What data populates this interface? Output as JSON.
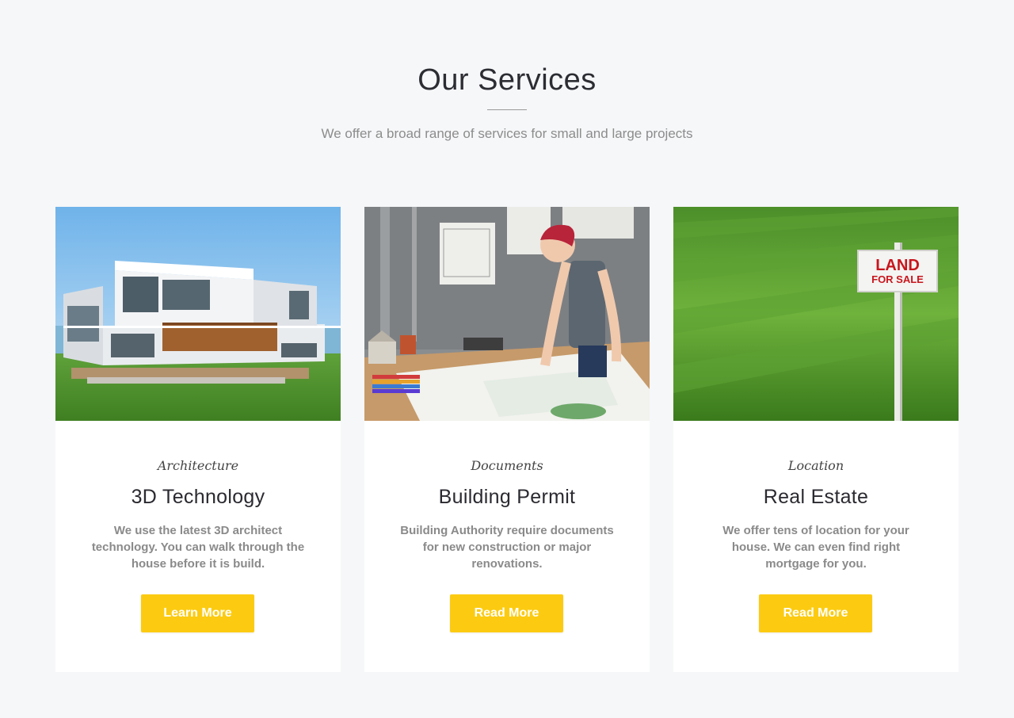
{
  "header": {
    "title": "Our Services",
    "subtitle": "We offer a broad range of services for small and large projects"
  },
  "cards": [
    {
      "category": "Architecture",
      "title": "3D Technology",
      "text": "We use the latest 3D architect technology. You can walk through the house before it is build.",
      "button_label": "Learn More"
    },
    {
      "category": "Documents",
      "title": "Building Permit",
      "text": "Building Authority require documents for new construction or major renovations.",
      "button_label": "Read More"
    },
    {
      "category": "Location",
      "title": "Real Estate",
      "text": "We offer tens of location for your house. We can even find right mortgage for you.",
      "button_label": "Read More"
    }
  ],
  "sign": {
    "line1": "LAND",
    "line2": "FOR SALE"
  },
  "colors": {
    "accent": "#fccb11",
    "background": "#f6f7f9",
    "card": "#ffffff"
  }
}
